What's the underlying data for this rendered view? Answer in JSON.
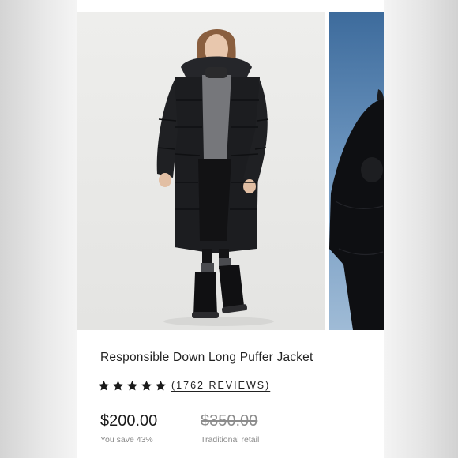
{
  "product": {
    "title": "Responsible Down Long Puffer Jacket",
    "rating": {
      "stars": 5,
      "max_stars": 5,
      "reviews_label": "(1762 REVIEWS)"
    },
    "price": "$200.00",
    "original_price": "$350.00",
    "savings_label": "You save 43%",
    "original_price_label": "Traditional retail"
  },
  "gallery": {
    "images": [
      {
        "name": "woman-in-long-black-puffer-coat"
      },
      {
        "name": "partial-second-photo-black-coat-blue-sky"
      }
    ]
  },
  "colors": {
    "star": "#1a1a1a",
    "coat": "#1c1d20",
    "photo_background": "#ececea",
    "sky": "#5d87b3"
  }
}
